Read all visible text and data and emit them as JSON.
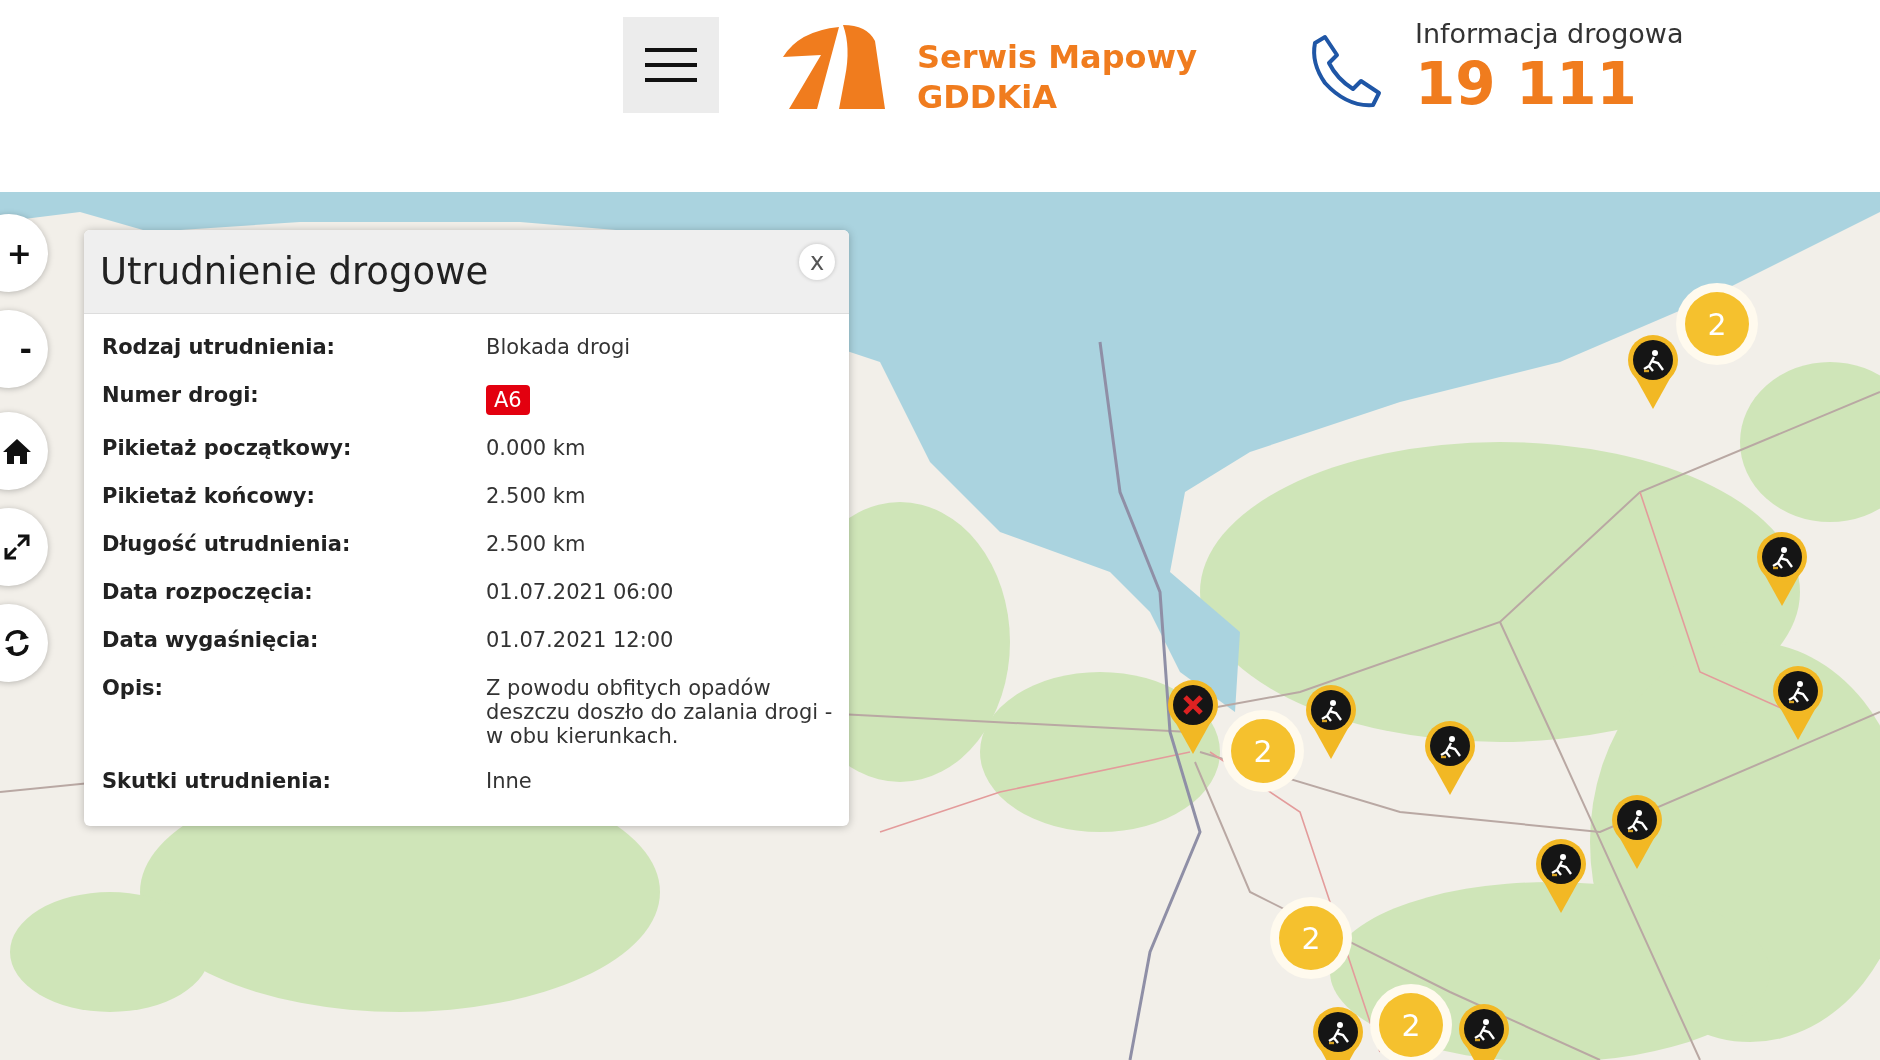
{
  "header": {
    "brand": {
      "line_1": "Serwis Mapowy",
      "line_2": "GDDKiA"
    },
    "hotline": {
      "label": "Informacja drogowa",
      "number": "19 111"
    }
  },
  "map": {
    "controls": [
      {
        "kind": "text",
        "label": "+"
      },
      {
        "kind": "text",
        "label": "-"
      },
      {
        "kind": "home"
      },
      {
        "kind": "fullscreen"
      },
      {
        "kind": "refresh"
      }
    ],
    "pins": [
      {
        "kind": "roadwork"
      },
      {
        "kind": "roadwork"
      },
      {
        "kind": "roadwork"
      },
      {
        "kind": "roadwork"
      },
      {
        "kind": "roadwork"
      },
      {
        "kind": "roadwork"
      },
      {
        "kind": "roadwork"
      },
      {
        "kind": "roadwork"
      },
      {
        "kind": "roadwork"
      },
      {
        "kind": "closure"
      }
    ],
    "clusters": [
      {
        "count": "2"
      },
      {
        "count": "2"
      },
      {
        "count": "2"
      },
      {
        "count": "2"
      }
    ]
  },
  "popup": {
    "title": "Utrudnienie drogowe",
    "close": "x",
    "rows": [
      {
        "label": "Rodzaj utrudnienia:",
        "value": "Blokada drogi",
        "kind": "text"
      },
      {
        "label": "Numer drogi:",
        "value": "A6",
        "kind": "badge"
      },
      {
        "label": "Pikietaż początkowy:",
        "value": "0.000 km",
        "kind": "text"
      },
      {
        "label": "Pikietaż końcowy:",
        "value": "2.500 km",
        "kind": "text"
      },
      {
        "label": "Długość utrudnienia:",
        "value": "2.500 km",
        "kind": "text"
      },
      {
        "label": "Data rozpoczęcia:",
        "value": "01.07.2021 06:00",
        "kind": "text"
      },
      {
        "label": "Data wygaśnięcia:",
        "value": "01.07.2021 12:00",
        "kind": "text"
      },
      {
        "label": "Opis:",
        "value": "Z powodu obfitych opadów deszczu doszło do zalania drogi - w obu kierunkach.",
        "kind": "text"
      },
      {
        "label": "Skutki utrudnienia:",
        "value": "Inne",
        "kind": "text"
      }
    ]
  }
}
